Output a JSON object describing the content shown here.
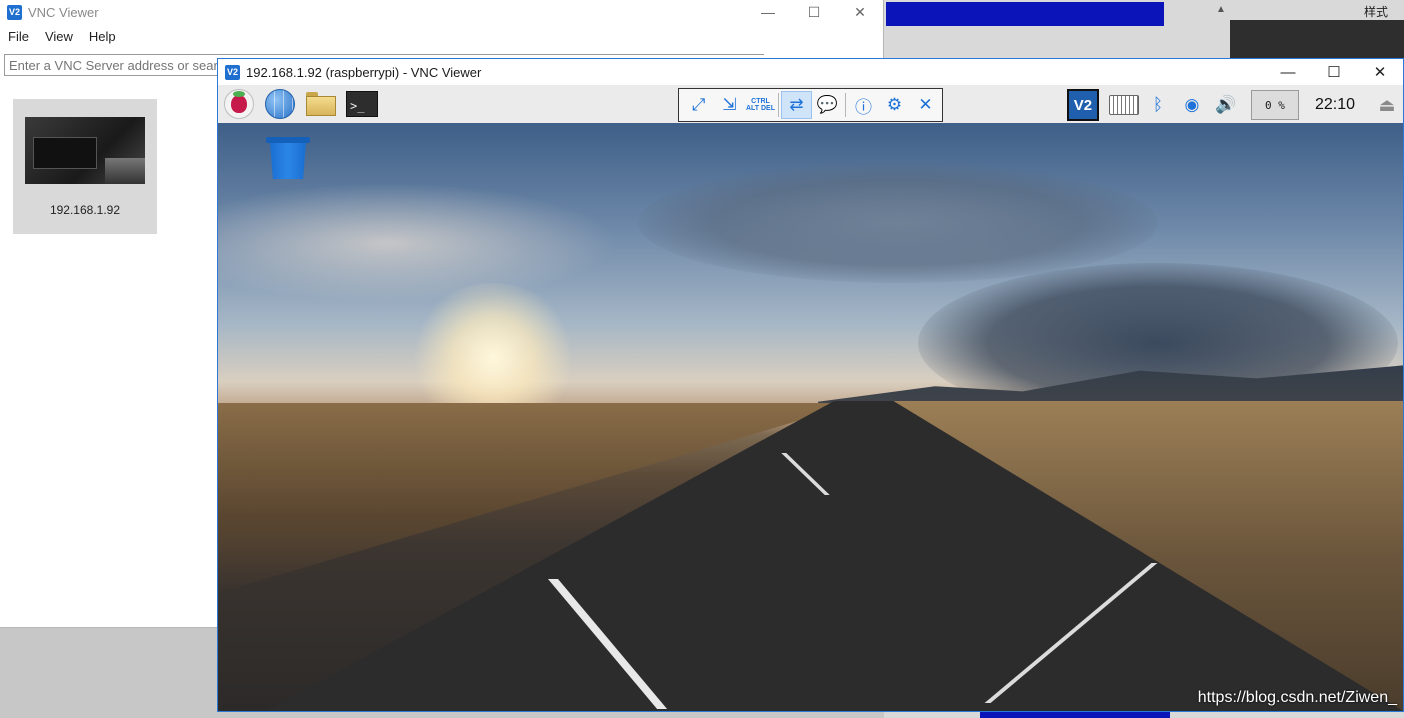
{
  "background_window": {
    "style_label": "样式"
  },
  "main_window": {
    "title": "VNC Viewer",
    "logo_text": "V2",
    "menu": [
      "File",
      "View",
      "Help"
    ],
    "address_placeholder": "Enter a VNC Server address or sear",
    "connections": [
      {
        "label": "192.168.1.92"
      }
    ]
  },
  "session_window": {
    "title": "192.168.1.92 (raspberrypi) - VNC Viewer",
    "logo_text": "V2",
    "panel_launchers": [
      "raspberry-menu-icon",
      "web-browser-icon",
      "file-manager-icon",
      "terminal-icon"
    ],
    "terminal_prompt": ">_",
    "toolbar": {
      "cad_text": "CTRL ALT DEL"
    },
    "tray": {
      "vnc_text": "V2",
      "cpu": "0 %",
      "clock": "22:10"
    },
    "desktop": {
      "watermark": "https://blog.csdn.net/Ziwen_"
    }
  }
}
